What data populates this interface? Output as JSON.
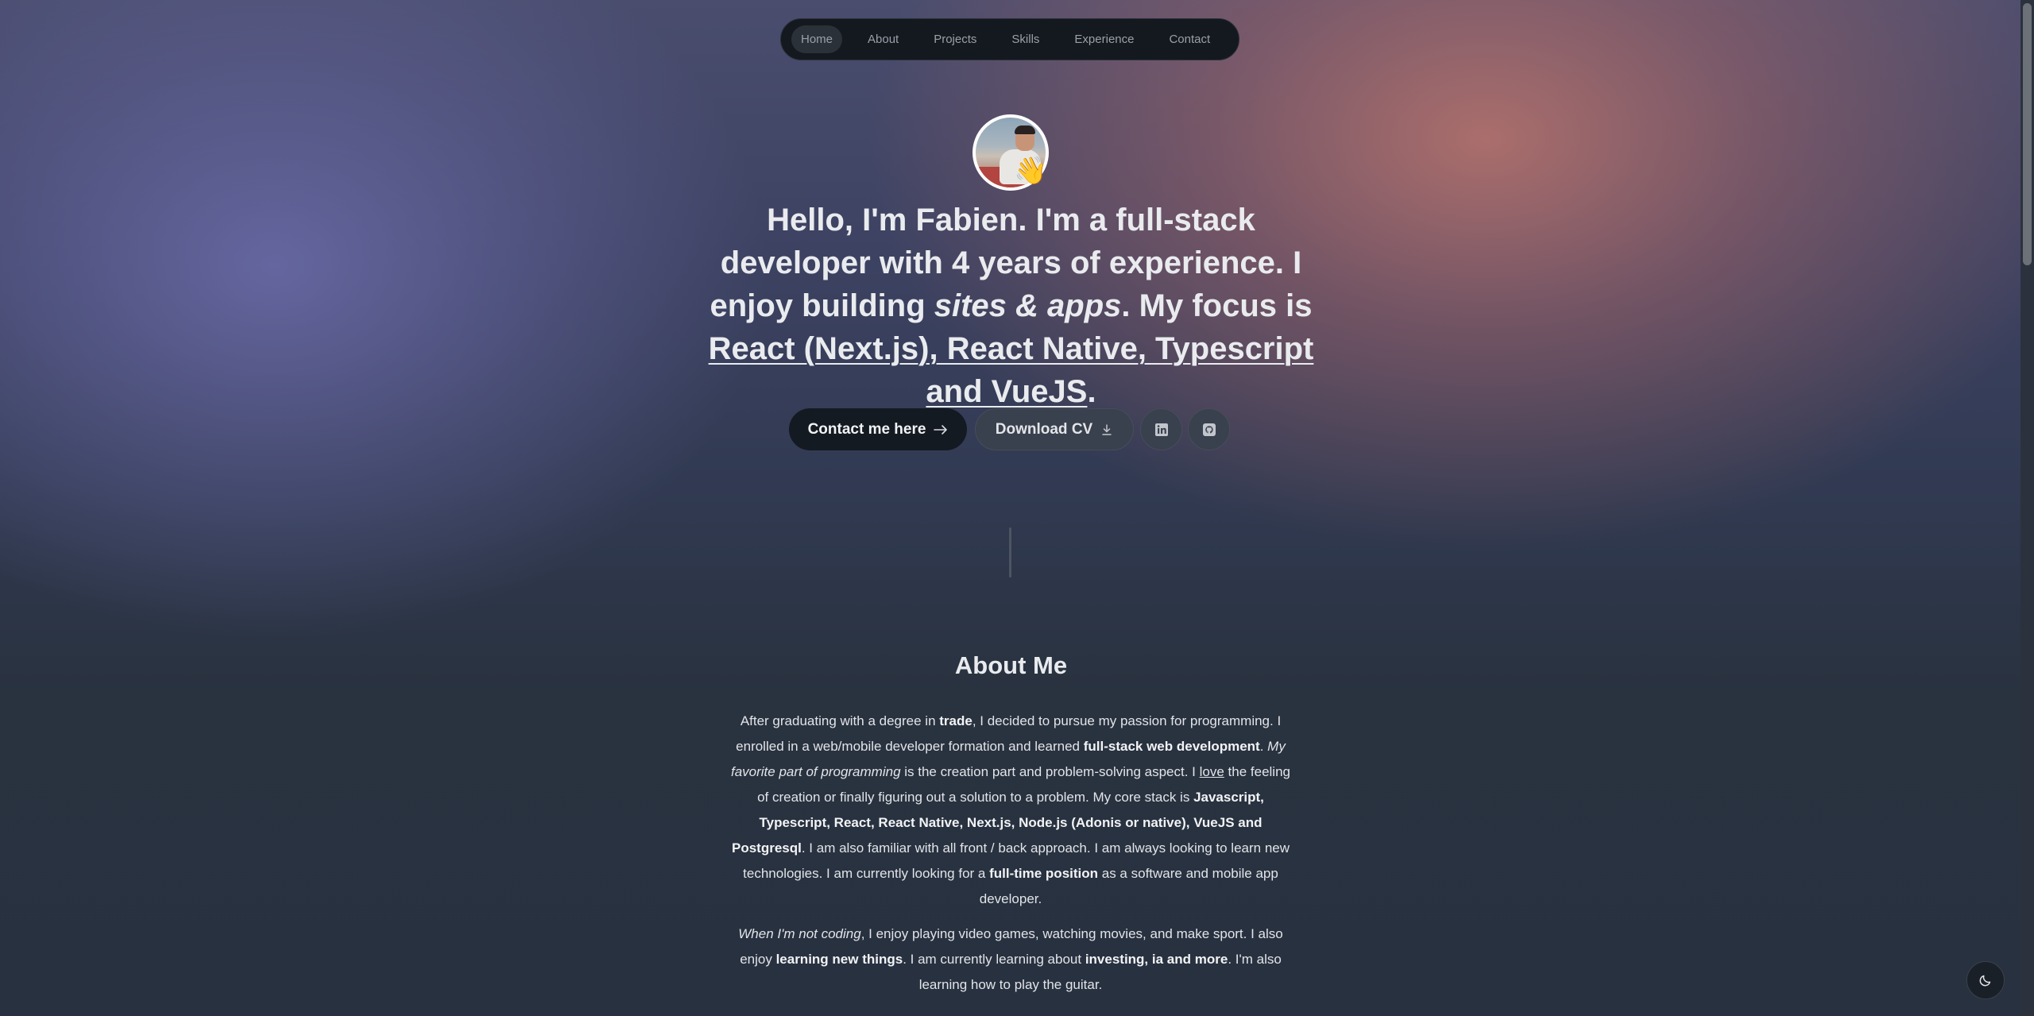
{
  "nav": {
    "items": [
      {
        "label": "Home",
        "active": true
      },
      {
        "label": "About",
        "active": false
      },
      {
        "label": "Projects",
        "active": false
      },
      {
        "label": "Skills",
        "active": false
      },
      {
        "label": "Experience",
        "active": false
      },
      {
        "label": "Contact",
        "active": false
      }
    ]
  },
  "hero": {
    "avatar_emoji": "👋",
    "greeting": "Hello, I'm Fabien.",
    "t1": " I'm a ",
    "role": "full-stack developer",
    "t2": " with ",
    "years": "4 years",
    "t3": " of experience. I enjoy building ",
    "things": "sites & apps",
    "t4": ". My focus is ",
    "focus": "React (Next.js), React Native, Typescript and VueJS",
    "t5": "."
  },
  "buttons": {
    "contact_label": "Contact me here",
    "contact_icon": "arrow-right-icon",
    "cv_label": "Download CV",
    "cv_icon": "download-icon",
    "linkedin_icon": "linkedin-icon",
    "github_icon": "github-icon"
  },
  "about": {
    "title": "About Me",
    "p1": {
      "a": "After graduating with a degree in ",
      "b": "trade",
      "c": ", I decided to pursue my passion for programming. I enrolled in a web/mobile developer formation and learned ",
      "d": "full-stack web development",
      "e": ". ",
      "f": "My favorite part of programming",
      "g": " is the creation part and problem-solving aspect. I ",
      "h": "love",
      "i": " the feeling of creation or finally figuring out a solution to a problem. My core stack is ",
      "j": "Javascript, Typescript, React, React Native, Next.js, Node.js (Adonis or native), VueJS and Postgresql",
      "k": ". I am also familiar with all front / back approach. I am always looking to learn new technologies. I am currently looking for a ",
      "l": "full-time position",
      "m": " as a software and mobile app developer."
    },
    "p2": {
      "a": "When I'm not coding",
      "b": ", I enjoy playing video games, watching movies, and make sport. I also enjoy ",
      "c": "learning new things",
      "d": ". I am currently learning about ",
      "e": "investing, ia and more",
      "f": ". I'm also learning how to play the guitar."
    }
  },
  "theme_toggle_icon": "moon-icon",
  "colors": {
    "nav_bg": "#14191f",
    "contact_button_bg": "#141a22",
    "secondary_button_bg": "#3a414e",
    "page_bg": "#283140"
  }
}
